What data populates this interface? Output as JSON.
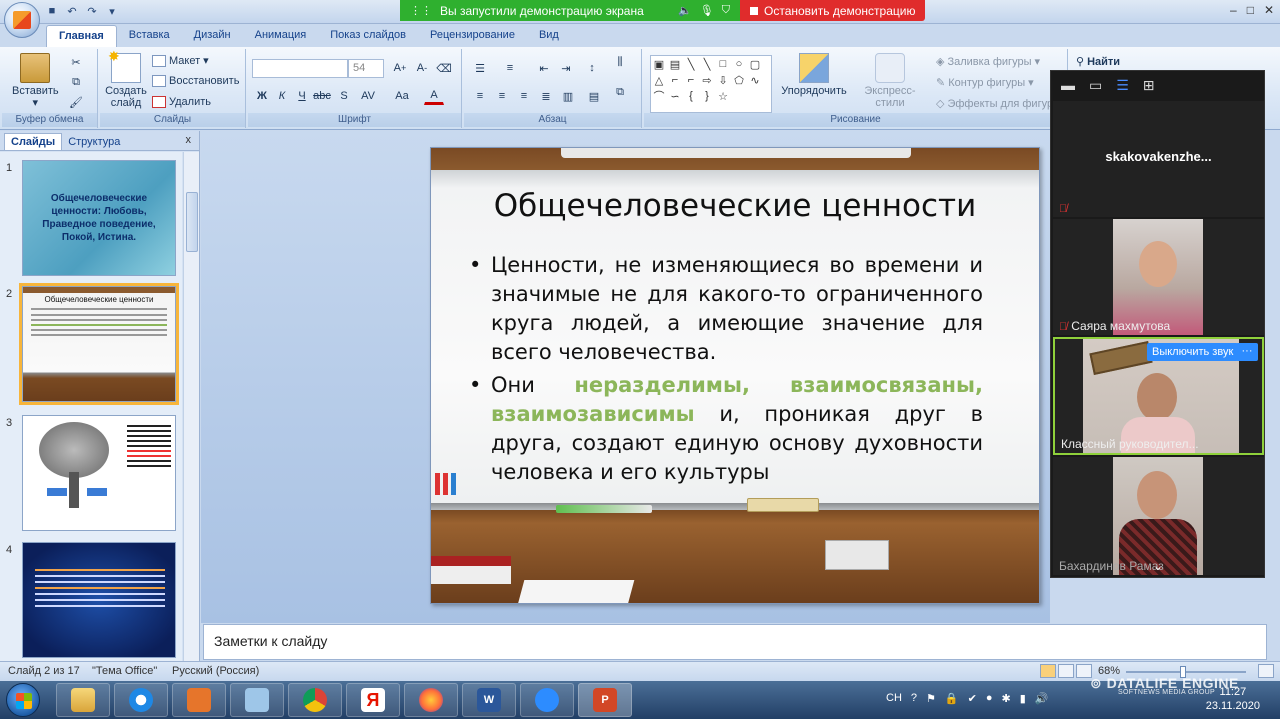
{
  "share_banner": {
    "message": "Вы запустили демонстрацию экрана",
    "stop_label": "Остановить демонстрацию",
    "colors": {
      "info": "#2fb02f",
      "stop": "#e02c2c"
    }
  },
  "tabs": [
    "Главная",
    "Вставка",
    "Дизайн",
    "Анимация",
    "Показ слайдов",
    "Рецензирование",
    "Вид"
  ],
  "ribbon": {
    "clipboard": {
      "label": "Буфер обмена",
      "paste": "Вставить"
    },
    "slides": {
      "label": "Слайды",
      "new_slide": "Создать слайд",
      "layout": "Макет",
      "reset": "Восстановить",
      "delete": "Удалить"
    },
    "font": {
      "label": "Шрифт",
      "size": "54"
    },
    "paragraph": {
      "label": "Абзац"
    },
    "drawing": {
      "label": "Рисование",
      "arrange": "Упорядочить",
      "quick_styles": "Экспресс-стили",
      "fill": "Заливка фигуры",
      "outline": "Контур фигуры",
      "effects": "Эффекты для фигур"
    },
    "editing": {
      "find": "Найти"
    }
  },
  "left_pane": {
    "tab_slides": "Слайды",
    "tab_outline": "Структура",
    "close": "x",
    "thumbs": [
      {
        "num": "1",
        "text": "Общечеловеческие ценности: Любовь, Праведное поведение, Покой, Истина."
      },
      {
        "num": "2",
        "title": "Общечеловеческие ценности"
      },
      {
        "num": "3"
      },
      {
        "num": "4"
      }
    ]
  },
  "slide": {
    "title": "Общечеловеческие ценности",
    "bullet1": "Ценности, не изменяющиеся во времени и значимые не для какого-то ограниченного круга людей, а имеющие значение для всего человечества.",
    "bullet2_start": "Они",
    "bullet2_highlight": "неразделимы, взаимосвязаны, взаимозависимы",
    "bullet2_end": "и, проникая друг в друга, создают единую основу духовности человека и его культуры",
    "highlight_color": "#8cb65a"
  },
  "notes_placeholder": "Заметки к слайду",
  "zoom_panel": {
    "participants": [
      {
        "name": "skakovakenzhe...",
        "muted": true,
        "video": false
      },
      {
        "name": "Саяра махмутова",
        "muted": true,
        "video": true
      },
      {
        "name": "Классный руководител...",
        "muted": false,
        "video": true,
        "unmute_label": "Выключить звук",
        "more": "···"
      },
      {
        "name": "Бахардинов Рамаз",
        "muted": false,
        "video": true
      }
    ]
  },
  "statusbar": {
    "slide_info": "Слайд 2 из 17",
    "theme": "\"Тема Office\"",
    "language": "Русский (Россия)",
    "zoom": "68%"
  },
  "taskbar": {
    "lang": "CH",
    "time": "11:27",
    "date": "23.11.2020"
  },
  "watermark": {
    "text": "DATALIFE ENGINE",
    "sub": "SOFTNEWS MEDIA GROUP"
  }
}
